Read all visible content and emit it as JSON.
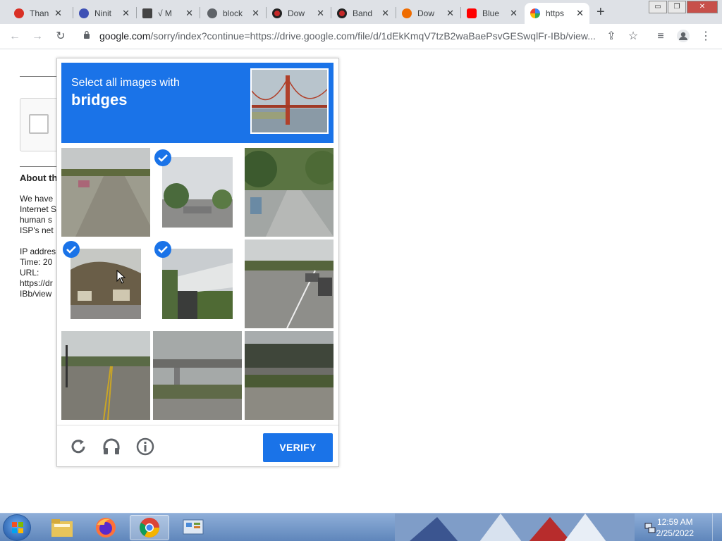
{
  "browser": {
    "tabs": [
      {
        "title": "Than",
        "favicon_color": "#d93025"
      },
      {
        "title": "Ninit",
        "favicon_color": "#3f51b5"
      },
      {
        "title": "√ M",
        "favicon_color": "#444444"
      },
      {
        "title": "block",
        "favicon_color": "#5f6368"
      },
      {
        "title": "Dow",
        "favicon_color": "#c62828"
      },
      {
        "title": "Band",
        "favicon_color": "#c62828"
      },
      {
        "title": "Dow",
        "favicon_color": "#ef6c00"
      },
      {
        "title": "Blue",
        "favicon_color": "#ff0000"
      },
      {
        "title": "https",
        "favicon_color": "#4285f4",
        "active": true
      }
    ],
    "new_tab_label": "+",
    "window_buttons": {
      "minimize": "▭",
      "restore": "❐",
      "close": "✕"
    },
    "url": {
      "host": "google.com",
      "rest": "/sorry/index?continue=https://drive.google.com/file/d/1dEkKmqV7tzB2waBaePsvGESwqlFr-IBb/view..."
    }
  },
  "page": {
    "about_heading": "About th",
    "para_lines": [
      "We have",
      "Internet S",
      "human s",
      "ISP's net"
    ],
    "meta_lines": [
      "IP addres",
      "Time: 20",
      "URL:",
      "https://dr",
      "IBb/view"
    ]
  },
  "captcha": {
    "instruction": "Select all images with",
    "object": "bridges",
    "verify_label": "VERIFY",
    "header_color": "#1a73e8",
    "tiles": [
      {
        "scene": "road-with-car",
        "selected": false
      },
      {
        "scene": "street-trees",
        "selected": true
      },
      {
        "scene": "tree-lined-road",
        "selected": false
      },
      {
        "scene": "hillside-houses",
        "selected": true
      },
      {
        "scene": "overpass-bridge",
        "selected": true
      },
      {
        "scene": "road-intersection",
        "selected": false
      },
      {
        "scene": "road-yellow-lines",
        "selected": false
      },
      {
        "scene": "highway-overpass",
        "selected": false
      },
      {
        "scene": "elevated-roadway",
        "selected": false
      }
    ],
    "footer_icons": [
      "reload-icon",
      "audio-headphones-icon",
      "info-icon"
    ]
  },
  "taskbar": {
    "apps": [
      "file-explorer",
      "firefox",
      "chrome",
      "control-panel"
    ],
    "active_app": "chrome",
    "clock_time": "12:59 AM",
    "clock_date": "2/25/2022"
  }
}
